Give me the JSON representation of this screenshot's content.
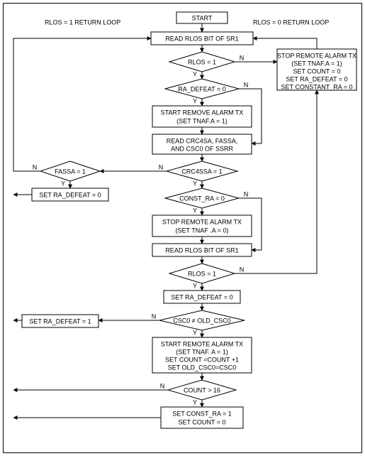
{
  "chart_data": {
    "type": "flowchart",
    "loop_labels": {
      "left": "RLOS = 1 RETURN LOOP",
      "right": "RLOS = 0 RETURN LOOP"
    },
    "nodes": {
      "start": {
        "type": "terminator",
        "text": "START"
      },
      "read_sr1_a": {
        "type": "process",
        "text": "READ RLOS BIT OF SR1"
      },
      "d_rlos_a": {
        "type": "decision",
        "text": "RLOS = 1"
      },
      "d_ra_defeat": {
        "type": "decision",
        "text": "RA_DEFEAT = 0"
      },
      "p_start_rem": {
        "type": "process",
        "lines": [
          "START REMOVE ALARM TX",
          "(SET TNAF.A = 1)"
        ]
      },
      "p_read_ssrr": {
        "type": "process",
        "lines": [
          "READ CRC4SA, FASSA,",
          "AND CSC0 OF SSRR"
        ]
      },
      "d_crc4ssa": {
        "type": "decision",
        "text": "CRC4SSA = 1"
      },
      "d_fassa": {
        "type": "decision",
        "text": "FASSA = 1"
      },
      "p_set_defeat0_a": {
        "type": "process",
        "text": "SET RA_DEFEAT = 0"
      },
      "d_const_ra": {
        "type": "decision",
        "text": "CONST_RA = 0"
      },
      "p_stop_tx": {
        "type": "process",
        "lines": [
          "STOP REMOTE ALARM TX",
          "(SET TNAF .A = 0)"
        ]
      },
      "p_read_sr1_b": {
        "type": "process",
        "text": "READ RLOS BIT OF SR1"
      },
      "d_rlos_b": {
        "type": "decision",
        "text": "RLOS = 1"
      },
      "p_set_defeat0_b": {
        "type": "process",
        "text": "SET RA_DEFEAT = 0"
      },
      "d_csc0": {
        "type": "decision",
        "text": "CSC0 ≠ OLD_CSC0"
      },
      "p_set_defeat1": {
        "type": "process",
        "text": "SET RA_DEFEAT = 1"
      },
      "p_start_alarm": {
        "type": "process",
        "lines": [
          "START REMOTE ALARM TX",
          "(SET TNAF. A = 1)",
          "SET COUNT =COUNT +1",
          "SET OLD_CSC0=CSC0"
        ]
      },
      "d_count": {
        "type": "decision",
        "text": "COUNT > 16"
      },
      "p_set_const": {
        "type": "process",
        "lines": [
          "SET CONST_RA = 1",
          "SET COUNT = 0"
        ]
      },
      "p_stop_remote": {
        "type": "process",
        "lines": [
          "STOP REMOTE ALARM TX",
          "(SET TNAF.A = 1)",
          "SET COUNT = 0",
          "SET RA_DEFEAT = 0",
          "SET CONSTANT_RA = 0"
        ]
      }
    },
    "yn_labels": {
      "y": "Y",
      "n": "N"
    }
  }
}
